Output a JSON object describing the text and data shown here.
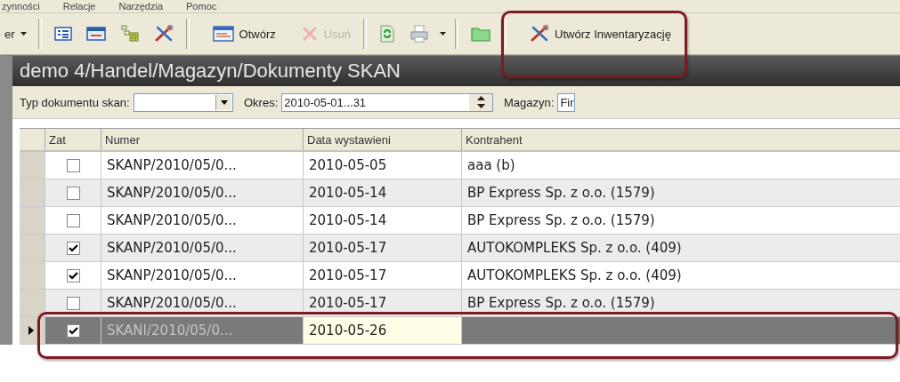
{
  "menu": [
    "zynności",
    "Relacje",
    "Narzędzia",
    "Pomoc"
  ],
  "toolbar": [
    {
      "kind": "menu",
      "label": "er"
    },
    {
      "kind": "separator"
    },
    {
      "kind": "list-view"
    },
    {
      "kind": "card-view"
    },
    {
      "kind": "tree-grid"
    },
    {
      "kind": "tools"
    },
    {
      "kind": "separator"
    },
    {
      "kind": "open-button",
      "label": "Otwórz",
      "disabled": false,
      "highlighted": false
    },
    {
      "kind": "delete-button",
      "label": "Usuń",
      "disabled": true,
      "highlighted": false
    },
    {
      "kind": "separator"
    },
    {
      "kind": "refresh"
    },
    {
      "kind": "printer"
    },
    {
      "kind": "caret"
    },
    {
      "kind": "separator"
    },
    {
      "kind": "folder"
    },
    {
      "kind": "separator"
    },
    {
      "kind": "create-button",
      "label": "Utwórz Inwentaryzację",
      "disabled": false,
      "highlighted": true
    }
  ],
  "title": "demo 4/Handel/Magazyn/Dokumenty SKAN",
  "filters": [
    {
      "kind": "combo",
      "label": "Typ dokumentu skan:"
    },
    {
      "kind": "spin",
      "label": "Okres:",
      "value": "2010-05-01...31"
    },
    {
      "kind": "text",
      "label": "Magazyn:",
      "value": "Fir"
    }
  ],
  "table": {
    "columns": [
      "Zat",
      "Numer",
      "Data wystawieni",
      "Kontrahent"
    ],
    "rows": [
      {
        "checked": false,
        "number": "SKANP/2010/05/0...",
        "date": "2010-05-05",
        "contractor": "aaa (b)",
        "selected": false,
        "current": false,
        "highlighted": false
      },
      {
        "checked": false,
        "number": "SKANP/2010/05/0...",
        "date": "2010-05-14",
        "contractor": "BP Express Sp. z o.o. (1579)",
        "selected": false,
        "current": false,
        "highlighted": false
      },
      {
        "checked": false,
        "number": "SKANP/2010/05/0...",
        "date": "2010-05-14",
        "contractor": "BP Express Sp. z o.o. (1579)",
        "selected": false,
        "current": false,
        "highlighted": false
      },
      {
        "checked": true,
        "number": "SKANP/2010/05/0...",
        "date": "2010-05-17",
        "contractor": "AUTOKOMPLEKS Sp. z o.o. (409)",
        "selected": false,
        "current": false,
        "highlighted": false
      },
      {
        "checked": true,
        "number": "SKANP/2010/05/0...",
        "date": "2010-05-17",
        "contractor": "AUTOKOMPLEKS Sp. z o.o. (409)",
        "selected": false,
        "current": false,
        "highlighted": false
      },
      {
        "checked": false,
        "number": "SKANP/2010/05/0...",
        "date": "2010-05-17",
        "contractor": "BP Express Sp. z o.o. (1579)",
        "selected": false,
        "current": false,
        "highlighted": false
      },
      {
        "checked": true,
        "number": "SKANI/2010/05/0...",
        "date": "2010-05-26",
        "selected": true,
        "current": true,
        "highlighted": true
      }
    ]
  }
}
